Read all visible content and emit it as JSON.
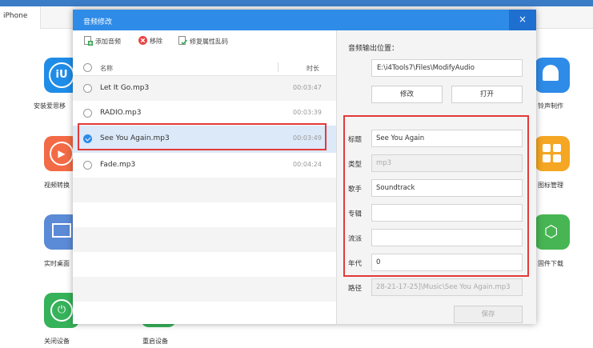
{
  "app": {
    "tab_iphone": "iPhone",
    "apps": [
      {
        "label": "安装爱思移",
        "color": "#1f8de8",
        "glyph": "iU"
      },
      {
        "label": "视频转换",
        "color": "#f36b46",
        "glyph": "▶"
      },
      {
        "label": "实时桌面",
        "color": "#5b8ad6",
        "glyph": "▭"
      },
      {
        "label": "关闭设备",
        "color": "#35b25a",
        "glyph": "⏻"
      },
      {
        "label": "重启设备",
        "color": "#35b25a",
        "glyph": ""
      },
      {
        "label": "铃声制作",
        "color": "#2e8be8",
        "glyph": "🔔"
      },
      {
        "label": "图标管理",
        "color": "#f5a623",
        "glyph": "▦"
      },
      {
        "label": "固件下载",
        "color": "#47b553",
        "glyph": "⬡"
      }
    ]
  },
  "dialog": {
    "title": "音频修改",
    "close_icon": "×",
    "toolbar": {
      "add": "添加音频",
      "remove": "移除",
      "fix": "修复属性乱码"
    },
    "list": {
      "col_name": "名称",
      "col_duration": "时长",
      "rows": [
        {
          "name": "Let It Go.mp3",
          "duration": "00:03:47",
          "checked": false
        },
        {
          "name": "RADIO.mp3",
          "duration": "00:03:39",
          "checked": false
        },
        {
          "name": "See You Again.mp3",
          "duration": "00:03:49",
          "checked": true
        },
        {
          "name": "Fade.mp3",
          "duration": "00:04:24",
          "checked": false
        }
      ]
    },
    "output": {
      "label": "音频输出位置：",
      "path": "E:\\i4Tools7\\Files\\ModifyAudio",
      "modify_button": "修改",
      "open_button": "打开"
    },
    "fields": {
      "title_label": "标题",
      "title_value": "See You Again",
      "type_label": "类型",
      "type_value": "mp3",
      "artist_label": "歌手",
      "artist_value": "Soundtrack",
      "album_label": "专辑",
      "album_value": "",
      "genre_label": "流派",
      "genre_value": "",
      "year_label": "年代",
      "year_value": "0",
      "path_label": "路径",
      "path_value": "28-21-17-25]\\Music\\See You Again.mp3"
    },
    "save_button": "保存"
  },
  "colors": {
    "accent": "#2e8be8",
    "highlight": "#e23a3a"
  }
}
